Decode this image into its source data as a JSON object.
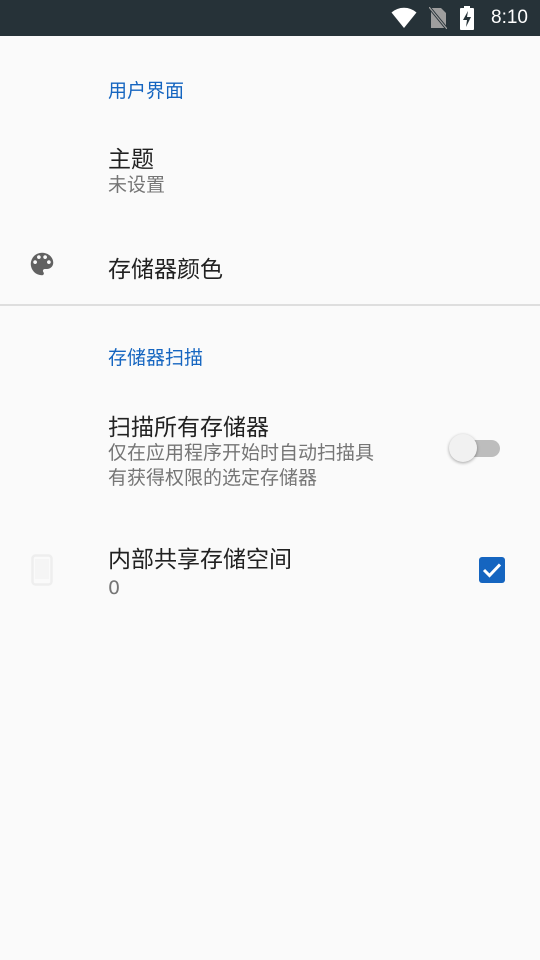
{
  "status_bar": {
    "time": "8:10",
    "icons": [
      "wifi-icon",
      "no-sim-icon",
      "battery-charging-icon"
    ]
  },
  "sections": [
    {
      "header": "用户界面",
      "items": [
        {
          "title": "主题",
          "summary": "未设置"
        },
        {
          "title": "存储器颜色",
          "icon": "palette-icon"
        }
      ]
    },
    {
      "header": "存储器扫描",
      "items": [
        {
          "title": "扫描所有存储器",
          "summary_line1": "仅在应用程序开始时自动扫描具",
          "summary_line2": "有获得权限的选定存储器",
          "control": "switch",
          "checked": false
        },
        {
          "title": "内部共享存储空间",
          "summary": "0",
          "icon": "phone-icon",
          "control": "checkbox",
          "checked": true
        }
      ]
    }
  ],
  "colors": {
    "accent": "#1565c0",
    "status_bar": "#263238",
    "background": "#fafafa"
  }
}
